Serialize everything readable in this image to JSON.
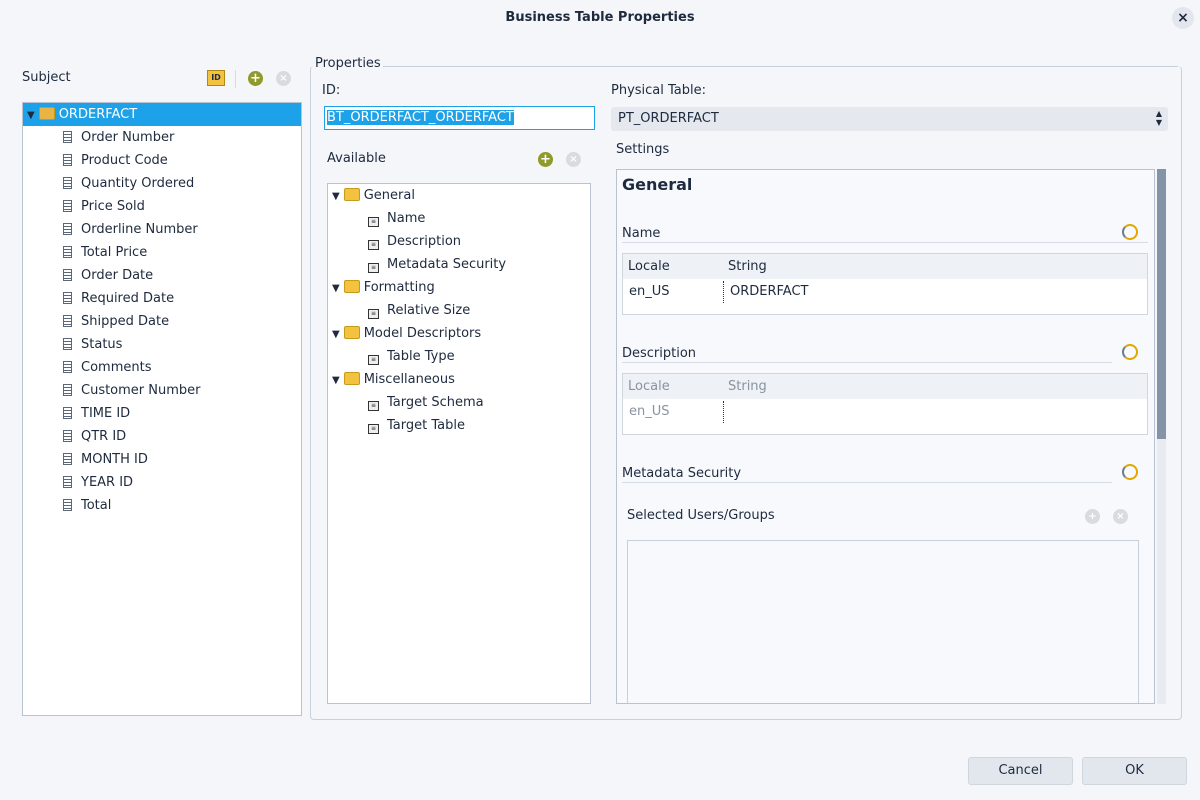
{
  "window": {
    "title": "Business Table Properties"
  },
  "subject": {
    "label": "Subject",
    "root": "ORDERFACT",
    "items": [
      "Order Number",
      "Product Code",
      "Quantity Ordered",
      "Price Sold",
      "Orderline Number",
      "Total Price",
      "Order Date",
      "Required Date",
      "Shipped Date",
      "Status",
      "Comments",
      "Customer Number",
      "TIME ID",
      "QTR ID",
      "MONTH ID",
      "YEAR ID",
      "Total"
    ]
  },
  "properties": {
    "label": "Properties",
    "id_label": "ID:",
    "id_value": "BT_ORDERFACT_ORDERFACT",
    "physical_label": "Physical Table:",
    "physical_value": "PT_ORDERFACT",
    "available_label": "Available",
    "groups": [
      {
        "name": "General",
        "items": [
          "Name",
          "Description",
          "Metadata Security"
        ]
      },
      {
        "name": "Formatting",
        "items": [
          "Relative Size"
        ]
      },
      {
        "name": "Model Descriptors",
        "items": [
          "Table Type"
        ]
      },
      {
        "name": "Miscellaneous",
        "items": [
          "Target Schema",
          "Target Table"
        ]
      }
    ]
  },
  "settings": {
    "label": "Settings",
    "heading": "General",
    "name_label": "Name",
    "col_locale": "Locale",
    "col_string": "String",
    "name_locale": "en_US",
    "name_string": "ORDERFACT",
    "desc_label": "Description",
    "desc_locale": "en_US",
    "security_label": "Metadata Security",
    "users_label": "Selected Users/Groups"
  },
  "buttons": {
    "cancel": "Cancel",
    "ok": "OK"
  }
}
